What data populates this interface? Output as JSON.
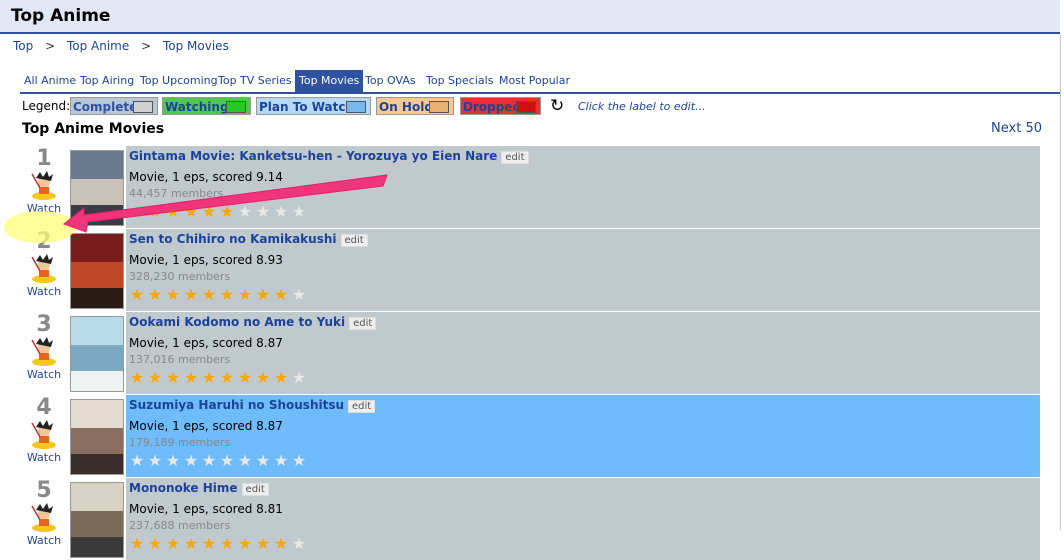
{
  "page": {
    "title": "Top Anime"
  },
  "breadcrumb": [
    "Top",
    "Top Anime",
    "Top Movies"
  ],
  "breadcrumb_sep": ">",
  "tabs": [
    "All Anime",
    "Top Airing",
    "Top Upcoming",
    "Top TV Series",
    "Top Movies",
    "Top OVAs",
    "Top Specials",
    "Most Popular"
  ],
  "active_tab": "Top Movies",
  "legend": {
    "label": "Legend:",
    "items": [
      {
        "label": "Complete",
        "bg": "#b7c7d6",
        "text": "#2e51a2",
        "swatch": "#d0d0d0"
      },
      {
        "label": "Watching",
        "bg": "#50c850",
        "text": "#1c439b",
        "swatch": "#28c828"
      },
      {
        "label": "Plan To Watch",
        "bg": "#b5d8f5",
        "text": "#1c439b",
        "swatch": "#7ab8f0"
      },
      {
        "label": "On Hold",
        "bg": "#f4c890",
        "text": "#1c439b",
        "swatch": "#e8b070"
      },
      {
        "label": "Dropped",
        "bg": "#e83030",
        "text": "#1c439b",
        "swatch": "#d01010"
      }
    ],
    "hint": "Click the label to edit...",
    "refresh_icon": "refresh-icon"
  },
  "section_title": "Top Anime Movies",
  "next_link": "Next 50",
  "edit_label": "edit",
  "watch_label": "Watch",
  "colors": {
    "accent": "#2e51a2",
    "link": "#1c439b",
    "grey_row": "#c0c9ce",
    "blue_row": "#6ebcfc",
    "arrow": "#f0357a",
    "star": "#f5a80d"
  },
  "anime": [
    {
      "rank": "1",
      "title": "Gintama Movie: Kanketsu-hen - Yorozuya yo Eien Nare",
      "meta": "Movie, 1 eps, scored 9.14",
      "members": "44,457 members",
      "stars": 6,
      "row_color": "#c0c9ce",
      "poster": [
        "#6b7a90",
        "#c9c2b9",
        "#3a3a48"
      ]
    },
    {
      "rank": "2",
      "title": "Sen to Chihiro no Kamikakushi",
      "meta": "Movie, 1 eps, scored 8.93",
      "members": "328,230 members",
      "stars": 9,
      "row_color": "#c0c9ce",
      "poster": [
        "#7a1d1d",
        "#c04828",
        "#2a1a14"
      ]
    },
    {
      "rank": "3",
      "title": "Ookami Kodomo no Ame to Yuki",
      "meta": "Movie, 1 eps, scored 8.87",
      "members": "137,016 members",
      "stars": 9,
      "row_color": "#c0c9ce",
      "poster": [
        "#b9dbe9",
        "#7da8c2",
        "#eef3f2"
      ]
    },
    {
      "rank": "4",
      "title": "Suzumiya Haruhi no Shoushitsu",
      "meta": "Movie, 1 eps, scored 8.87",
      "members": "179,189 members",
      "stars": 0,
      "row_color": "#6ebcfc",
      "poster": [
        "#e3dbcf",
        "#8a6f60",
        "#39302c"
      ]
    },
    {
      "rank": "5",
      "title": "Mononoke Hime",
      "meta": "Movie, 1 eps, scored 8.81",
      "members": "237,688 members",
      "stars": 9,
      "row_color": "#c0c9ce",
      "poster": [
        "#d8d2c5",
        "#7a6a58",
        "#3a3a3a"
      ]
    }
  ]
}
